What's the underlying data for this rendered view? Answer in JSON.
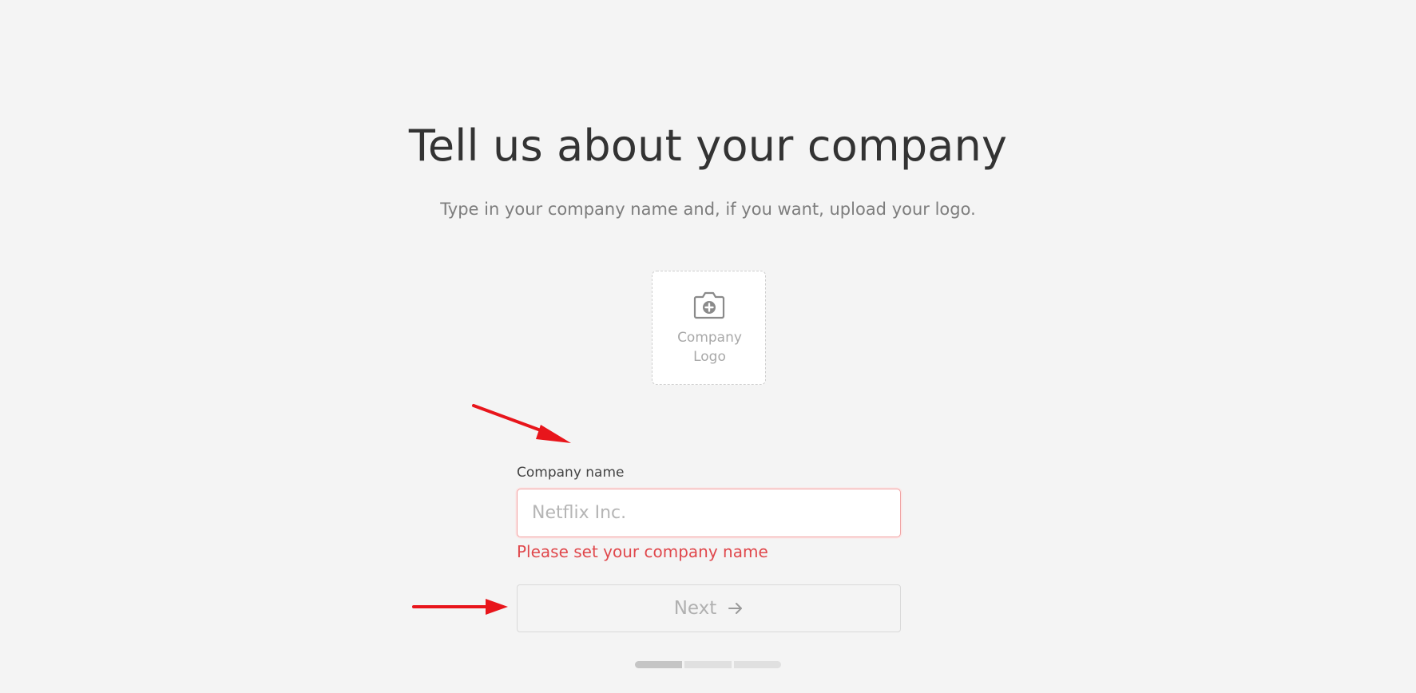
{
  "header": {
    "title": "Tell us about your company",
    "subtitle": "Type in your company name and, if you want, upload your logo."
  },
  "logo_upload": {
    "icon": "camera-add-icon",
    "label_line1": "Company",
    "label_line2": "Logo"
  },
  "company_field": {
    "label": "Company name",
    "value": "",
    "placeholder": "Netflix Inc.",
    "error": "Please set your company name",
    "state": "error"
  },
  "next_button": {
    "label": "Next",
    "icon": "arrow-right-icon",
    "disabled": true
  },
  "progress": {
    "total_steps": 3,
    "current_step": 1
  },
  "annotations": {
    "color": "#e8151b",
    "arrows": [
      "pointing-to-company-name-field",
      "pointing-to-next-button"
    ]
  },
  "colors": {
    "background": "#f4f4f4",
    "error": "#e0484c",
    "annotation": "#e8151b"
  }
}
